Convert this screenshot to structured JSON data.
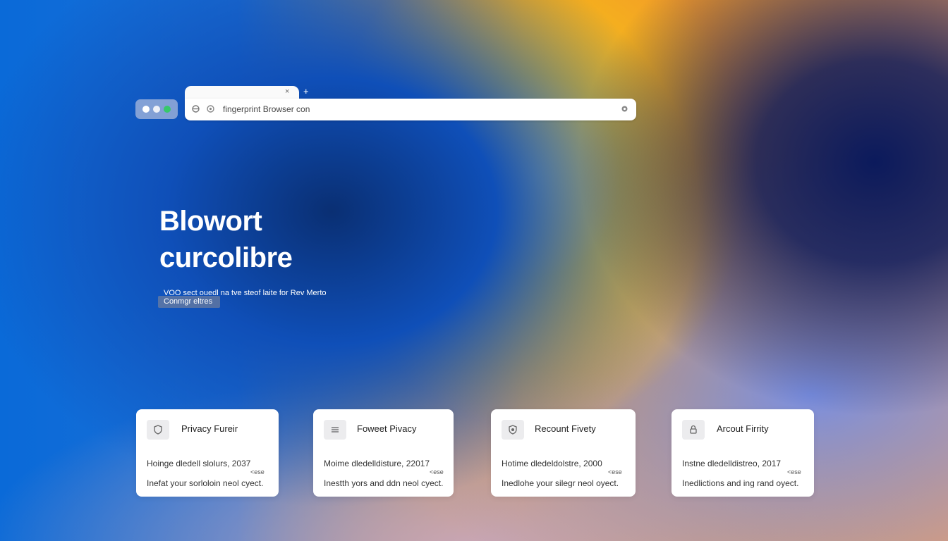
{
  "browser": {
    "tab_close": "×",
    "tab_new": "+",
    "url": "fingerprint Browser con"
  },
  "hero": {
    "title_line1": "Blowort",
    "title_line2": "curcolibre",
    "subtitle": "VOO sect ouedl na tve steof laite for Rev Merto",
    "chip": "Conmgr eltres"
  },
  "cards": [
    {
      "title": "Privacy Fureir",
      "line1": "Hoinge dledell slolurs, 2037",
      "close": "<ese",
      "line2": "Inefat your sorloloin neol cyect.",
      "icon": "shield-icon"
    },
    {
      "title": "Foweet Pivacy",
      "line1": "Moime dledelldisture, 22017",
      "close": "<ese",
      "line2": "Inestth yors and ddn neol cyect.",
      "icon": "list-icon"
    },
    {
      "title": "Recount Fivety",
      "line1": "Hotime dledeldolstre, 2000",
      "close": "<ese",
      "line2": "Inedlohe your silegr neol oyect.",
      "icon": "badge-icon"
    },
    {
      "title": "Arcout Firrity",
      "line1": "Instne dledelldistreo, 2017",
      "close": "<ese",
      "line2": "Inedlictions and ing rand oyect.",
      "icon": "lock-icon"
    }
  ]
}
